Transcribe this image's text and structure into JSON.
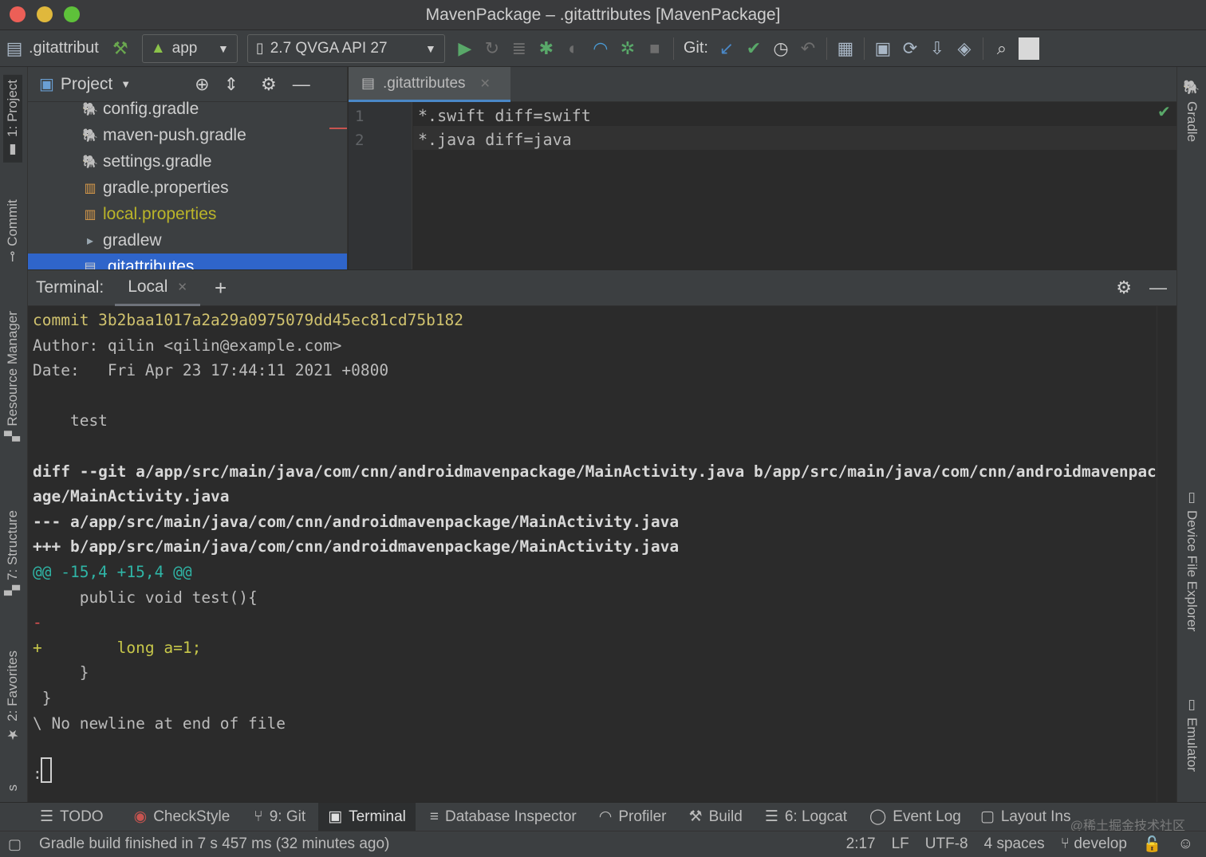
{
  "window": {
    "title": "MavenPackage – .gitattributes [MavenPackage]"
  },
  "toolbar": {
    "file": ".gitattribut",
    "run_config": "app",
    "device": "2.7  QVGA API 27",
    "git_label": "Git:"
  },
  "left_strip": [
    "1: Project",
    "Commit",
    "Resource Manager",
    "7: Structure",
    "2: Favorites",
    "s"
  ],
  "right_strip": [
    "Gradle",
    "Device File Explorer",
    "Emulator"
  ],
  "project": {
    "header": "Project",
    "files": [
      {
        "name": "config.gradle",
        "color": "#cfcfcf"
      },
      {
        "name": "maven-push.gradle",
        "color": "#cfcfcf"
      },
      {
        "name": "settings.gradle",
        "color": "#cfcfcf"
      },
      {
        "name": "gradle.properties",
        "color": "#cfcfcf"
      },
      {
        "name": "local.properties",
        "color": "#bbb529"
      },
      {
        "name": "gradlew",
        "color": "#cfcfcf"
      },
      {
        "name": ".gitattributes",
        "color": "#ffffff"
      }
    ]
  },
  "editor": {
    "tab": ".gitattributes",
    "lines": [
      {
        "num": "1",
        "text": "*.swift diff=swift"
      },
      {
        "num": "2",
        "text": "*.java diff=java"
      }
    ]
  },
  "terminal": {
    "label": "Terminal:",
    "tab": "Local",
    "lines": [
      {
        "text": "commit 3b2baa1017a2a29a0975079dd45ec81cd75b182",
        "color": "#d0c26e",
        "bold": false
      },
      {
        "text": "Author: qilin <qilin@example.com>",
        "color": "#bbbbbb",
        "bold": false
      },
      {
        "text": "Date:   Fri Apr 23 17:44:11 2021 +0800",
        "color": "#bbbbbb",
        "bold": false
      },
      {
        "text": "",
        "color": "#bbbbbb",
        "bold": false
      },
      {
        "text": "    test",
        "color": "#bbbbbb",
        "bold": false
      },
      {
        "text": "",
        "color": "#bbbbbb",
        "bold": false
      },
      {
        "text": "diff --git a/app/src/main/java/com/cnn/androidmavenpackage/MainActivity.java b/app/src/main/java/com/cnn/androidmavenpack",
        "color": "#d8d8d8",
        "bold": true
      },
      {
        "text": "age/MainActivity.java",
        "color": "#d8d8d8",
        "bold": true
      },
      {
        "text": "--- a/app/src/main/java/com/cnn/androidmavenpackage/MainActivity.java",
        "color": "#d8d8d8",
        "bold": true
      },
      {
        "text": "+++ b/app/src/main/java/com/cnn/androidmavenpackage/MainActivity.java",
        "color": "#d8d8d8",
        "bold": true
      },
      {
        "text": "@@ -15,4 +15,4 @@",
        "color": "#2fb5a6",
        "bold": false
      },
      {
        "text": "     public void test(){",
        "color": "#bbbbbb",
        "bold": false
      },
      {
        "text": "-",
        "color": "#e05252",
        "bold": false
      },
      {
        "text": "+        long a=1;",
        "color": "#c8c84a",
        "bold": false
      },
      {
        "text": "     }",
        "color": "#bbbbbb",
        "bold": false
      },
      {
        "text": " }",
        "color": "#bbbbbb",
        "bold": false
      },
      {
        "text": "\\ No newline at end of file",
        "color": "#bbbbbb",
        "bold": false
      },
      {
        "text": "",
        "color": "#bbbbbb",
        "bold": false
      },
      {
        "text": ":",
        "color": "#bbbbbb",
        "bold": false
      }
    ]
  },
  "tool_windows": [
    {
      "label": "TODO",
      "icon": "list-icon",
      "active": false
    },
    {
      "label": "CheckStyle",
      "icon": "checkstyle-icon",
      "active": false
    },
    {
      "label": "9: Git",
      "icon": "git-branch-icon",
      "active": false
    },
    {
      "label": "Terminal",
      "icon": "terminal-icon",
      "active": true
    },
    {
      "label": "Database Inspector",
      "icon": "database-icon",
      "active": false
    },
    {
      "label": "Profiler",
      "icon": "profiler-icon",
      "active": false
    },
    {
      "label": "Build",
      "icon": "hammer-icon",
      "active": false
    },
    {
      "label": "6: Logcat",
      "icon": "logcat-icon",
      "active": false
    },
    {
      "label": "Event Log",
      "icon": "event-log-icon",
      "active": false
    },
    {
      "label": "Layout Ins",
      "icon": "layout-inspector-icon",
      "active": false
    }
  ],
  "status": {
    "message": "Gradle build finished in 7 s 457 ms (32 minutes ago)",
    "position": "2:17",
    "line_sep": "LF",
    "encoding": "UTF-8",
    "indent": "4 spaces",
    "branch": "develop"
  },
  "watermark": "@稀土掘金技术社区",
  "colors": {
    "accent": "#4a88c7",
    "selection": "#2f65ca",
    "run_green": "#59a869"
  }
}
